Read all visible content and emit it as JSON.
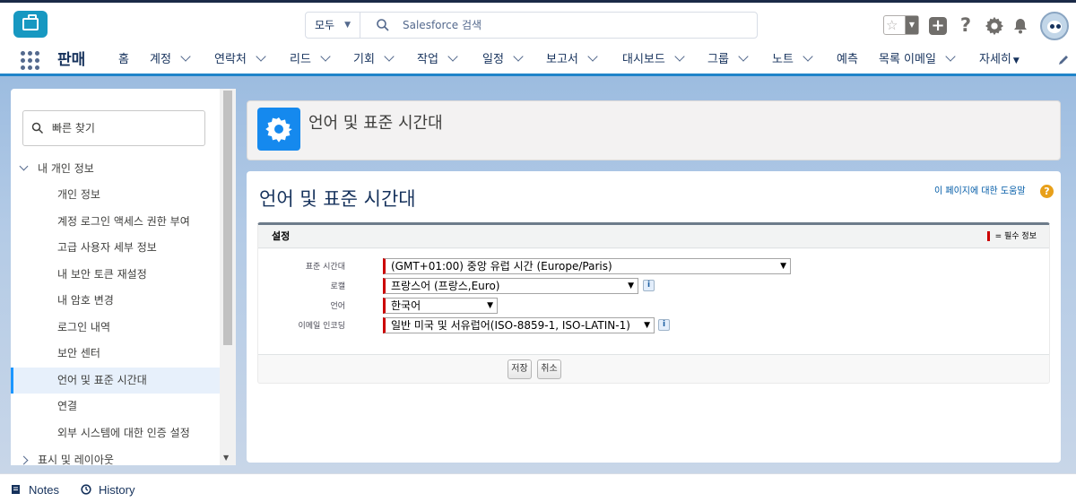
{
  "header": {
    "search_scope": "모두",
    "search_placeholder": "Salesforce 검색"
  },
  "nav": {
    "app_name": "판매",
    "items": [
      {
        "label": "홈"
      },
      {
        "label": "계정"
      },
      {
        "label": "연락처"
      },
      {
        "label": "리드"
      },
      {
        "label": "기회"
      },
      {
        "label": "작업"
      },
      {
        "label": "일정"
      },
      {
        "label": "보고서"
      },
      {
        "label": "대시보드"
      },
      {
        "label": "그룹"
      },
      {
        "label": "노트"
      },
      {
        "label": "예측"
      },
      {
        "label": "목록 이메일"
      },
      {
        "label": "자세히"
      }
    ]
  },
  "sidebar": {
    "quickfind_placeholder": "빠른 찾기",
    "group1": "내 개인 정보",
    "items": [
      {
        "label": "개인 정보"
      },
      {
        "label": "계정 로그인 액세스 권한 부여"
      },
      {
        "label": "고급 사용자 세부 정보"
      },
      {
        "label": "내 보안 토큰 재설정"
      },
      {
        "label": "내 암호 변경"
      },
      {
        "label": "로그인 내역"
      },
      {
        "label": "보안 센터"
      },
      {
        "label": "언어 및 표준 시간대"
      },
      {
        "label": "연결"
      },
      {
        "label": "외부 시스템에 대한 인증 설정"
      }
    ],
    "group2": "표시 및 레이아웃"
  },
  "page": {
    "header_title": "언어 및 표준 시간대",
    "title": "언어 및 표준 시간대",
    "help_link": "이 페이지에 대한 도움말",
    "section_title": "설정",
    "required_note": "= 필수 정보",
    "fields": {
      "timezone_label": "표준 시간대",
      "timezone_value": "(GMT+01:00) 중앙 유럽 시간 (Europe/Paris)",
      "locale_label": "로캘",
      "locale_value": "프랑스어 (프랑스,Euro)",
      "language_label": "언어",
      "language_value": "한국어",
      "encoding_label": "이메일 인코딩",
      "encoding_value": "일반 미국 및 서유럽어(ISO-8859-1, ISO-LATIN-1)"
    },
    "save_label": "저장",
    "cancel_label": "취소"
  },
  "footer": {
    "notes_label": "Notes",
    "history_label": "History"
  },
  "colors": {
    "brand": "#1798c1",
    "nav_underline": "#1f84c9",
    "required": "#cc0000",
    "active_item": "#e7f0fb"
  },
  "icons": [
    "briefcase-icon",
    "search-icon",
    "star-icon",
    "plus-icon",
    "help-icon",
    "gear-icon",
    "bell-icon",
    "avatar",
    "waffle-icon",
    "pencil-icon",
    "notes-icon",
    "history-icon",
    "info-icon",
    "help-badge-icon"
  ]
}
